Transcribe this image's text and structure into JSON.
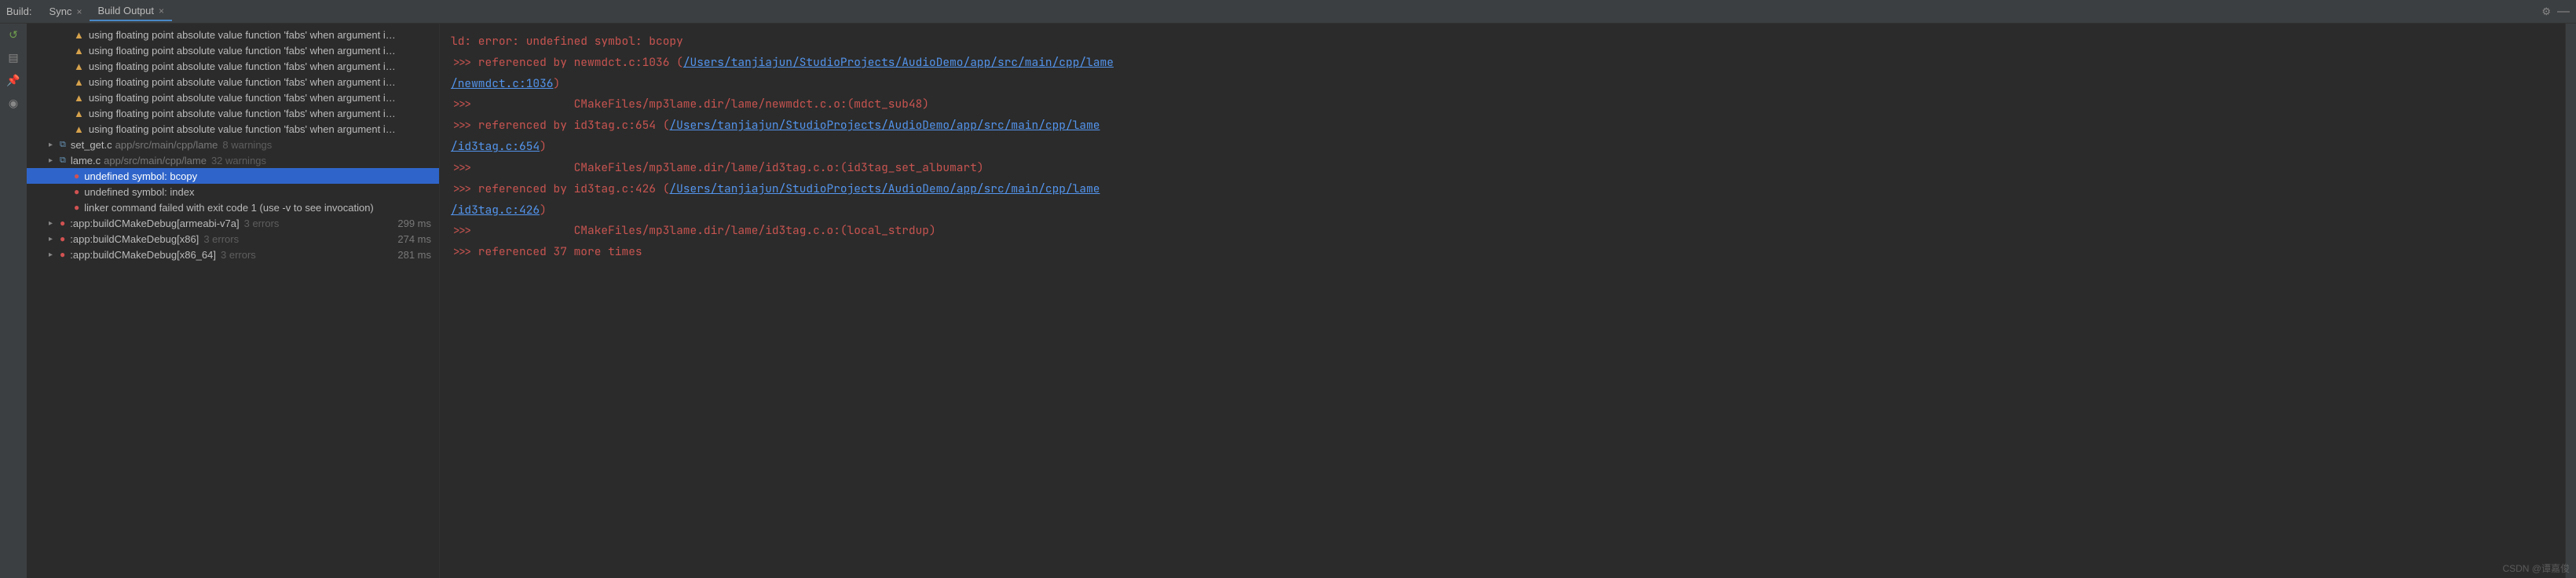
{
  "header": {
    "label": "Build:",
    "tabs": [
      {
        "label": "Sync",
        "active": false
      },
      {
        "label": "Build Output",
        "active": true
      }
    ]
  },
  "tree": {
    "warnings": [
      "using floating point absolute value function 'fabs' when argument i…",
      "using floating point absolute value function 'fabs' when argument i…",
      "using floating point absolute value function 'fabs' when argument i…",
      "using floating point absolute value function 'fabs' when argument i…",
      "using floating point absolute value function 'fabs' when argument i…",
      "using floating point absolute value function 'fabs' when argument i…",
      "using floating point absolute value function 'fabs' when argument i…"
    ],
    "files": [
      {
        "name": "set_get.c",
        "path": "app/src/main/cpp/lame",
        "suffix": "8 warnings"
      },
      {
        "name": "lame.c",
        "path": "app/src/main/cpp/lame",
        "suffix": "32 warnings"
      }
    ],
    "errors": [
      {
        "text": "undefined symbol: bcopy",
        "selected": true
      },
      {
        "text": "undefined symbol: index",
        "selected": false
      },
      {
        "text": "linker command failed with exit code 1 (use -v to see invocation)",
        "selected": false
      }
    ],
    "tasks": [
      {
        "name": ":app:buildCMakeDebug[armeabi-v7a]",
        "suffix": "3 errors",
        "time": "299 ms"
      },
      {
        "name": ":app:buildCMakeDebug[x86]",
        "suffix": "3 errors",
        "time": "274 ms"
      },
      {
        "name": ":app:buildCMakeDebug[x86_64]",
        "suffix": "3 errors",
        "time": "281 ms"
      }
    ]
  },
  "console": {
    "lines": [
      {
        "segments": [
          {
            "text": "ld: error: undefined symbol: bcopy"
          }
        ]
      },
      {
        "segments": [
          {
            "text": ">>> referenced by newmdct.c:1036 ("
          },
          {
            "text": "/Users/tanjiajun/StudioProjects/AudioDemo/app/src/main/cpp/lame",
            "link": true
          }
        ]
      },
      {
        "segments": [
          {
            "text": "/newmdct.c:1036",
            "link": true
          },
          {
            "text": ")"
          }
        ]
      },
      {
        "segments": [
          {
            "text": ">>>               CMakeFiles/mp3lame.dir/lame/newmdct.c.o:(mdct_sub48)"
          }
        ]
      },
      {
        "segments": [
          {
            "text": ">>> referenced by id3tag.c:654 ("
          },
          {
            "text": "/Users/tanjiajun/StudioProjects/AudioDemo/app/src/main/cpp/lame",
            "link": true
          }
        ]
      },
      {
        "segments": [
          {
            "text": "/id3tag.c:654",
            "link": true
          },
          {
            "text": ")"
          }
        ]
      },
      {
        "segments": [
          {
            "text": ">>>               CMakeFiles/mp3lame.dir/lame/id3tag.c.o:(id3tag_set_albumart)"
          }
        ]
      },
      {
        "segments": [
          {
            "text": ">>> referenced by id3tag.c:426 ("
          },
          {
            "text": "/Users/tanjiajun/StudioProjects/AudioDemo/app/src/main/cpp/lame",
            "link": true
          }
        ]
      },
      {
        "segments": [
          {
            "text": "/id3tag.c:426",
            "link": true
          },
          {
            "text": ")"
          }
        ]
      },
      {
        "segments": [
          {
            "text": ">>>               CMakeFiles/mp3lame.dir/lame/id3tag.c.o:(local_strdup)"
          }
        ]
      },
      {
        "segments": [
          {
            "text": ">>> referenced 37 more times"
          }
        ]
      }
    ]
  },
  "watermark": "CSDN @谭嘉俊"
}
